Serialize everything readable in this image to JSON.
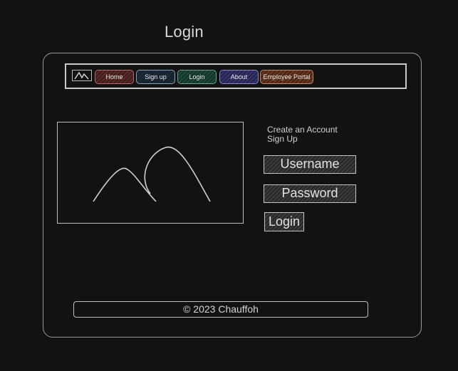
{
  "page": {
    "title": "Login"
  },
  "navbar": {
    "logo_icon": "mountain-logo-icon",
    "items": [
      {
        "label": "Home",
        "color": "#b26a6a"
      },
      {
        "label": "Sign up",
        "color": "#8aa0b8"
      },
      {
        "label": "Login",
        "color": "#6aa08a"
      },
      {
        "label": "About",
        "color": "#8a86c0"
      },
      {
        "label": "Employee Portal",
        "color": "#c08a6a"
      }
    ]
  },
  "main": {
    "image_icon": "image-placeholder-icon",
    "create_account_label": "Create an Account",
    "sign_up_label": "Sign Up",
    "username_label": "Username",
    "password_label": "Password",
    "login_button_label": "Login"
  },
  "footer": {
    "text": "© 2023 Chauffoh"
  }
}
